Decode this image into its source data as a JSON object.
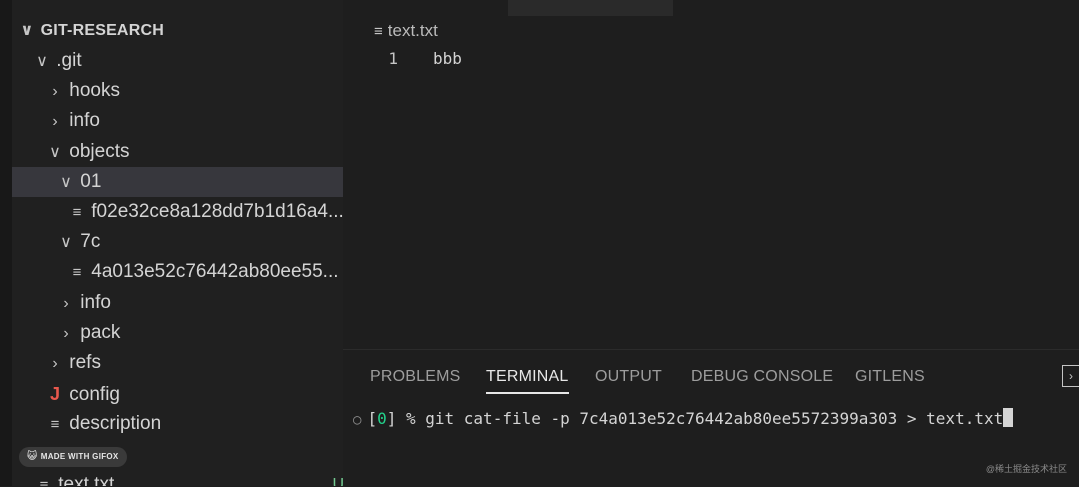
{
  "explorer": {
    "root": "GIT-RESEARCH",
    "items": [
      {
        "label": ".git",
        "chevron": "∨"
      },
      {
        "label": "hooks",
        "chevron": "›"
      },
      {
        "label": "info",
        "chevron": "›"
      },
      {
        "label": "objects",
        "chevron": "∨"
      },
      {
        "label": "01",
        "chevron": "∨"
      },
      {
        "label": "f02e32ce8a128dd7b1d16a4...",
        "icon": "≡"
      },
      {
        "label": "7c",
        "chevron": "∨"
      },
      {
        "label": "4a013e52c76442ab80ee55...",
        "icon": "≡"
      },
      {
        "label": "info",
        "chevron": "›"
      },
      {
        "label": "pack",
        "chevron": "›"
      },
      {
        "label": "refs",
        "chevron": "›"
      },
      {
        "label": "config",
        "icon": "J"
      },
      {
        "label": "description",
        "icon": "≡"
      },
      {
        "label": "text.txt",
        "icon": "≡",
        "badge": "U"
      }
    ]
  },
  "gifox_badge": "MADE WITH GIFOX",
  "editor": {
    "breadcrumb": "text.txt",
    "lines": [
      {
        "number": "1",
        "text": "bbb"
      }
    ]
  },
  "panel": {
    "tabs": [
      "PROBLEMS",
      "TERMINAL",
      "OUTPUT",
      "DEBUG CONSOLE",
      "GITLENS"
    ],
    "active_tab": "TERMINAL"
  },
  "terminal": {
    "open_bracket": "[",
    "exit_code": "0",
    "close_bracket": "]",
    "command": " % git cat-file -p 7c4a013e52c76442ab80ee5572399a303 > text.txt"
  },
  "watermark": "@稀土掘金技术社区",
  "colors": {
    "accent_green": "#23d18b",
    "git_config": "#e8584d",
    "untracked": "#73c991"
  }
}
